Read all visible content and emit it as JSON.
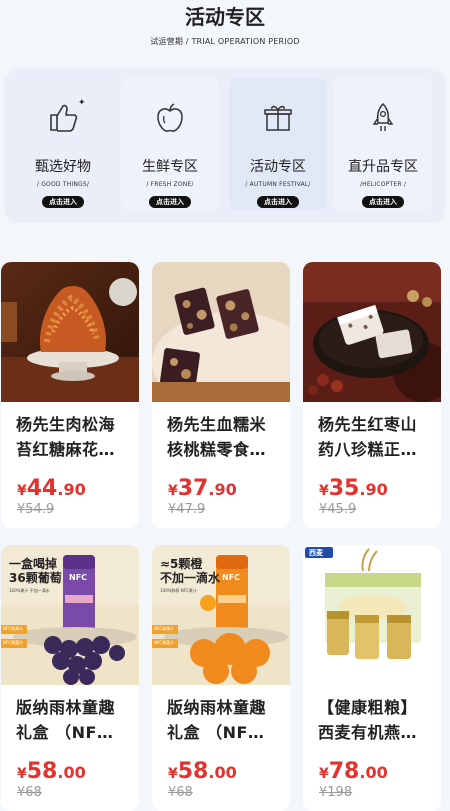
{
  "header": {
    "title": "活动专区",
    "subtitle": "试运营期 / TRIAL OPERATION PERIOD"
  },
  "categories": [
    {
      "label": "甄选好物",
      "sub": "/ GOOD THINGS/",
      "enter": "点击进入",
      "icon": "thumbs-up-icon"
    },
    {
      "label": "生鲜专区",
      "sub": "/ FRESH ZONE/",
      "enter": "点击进入",
      "icon": "apple-icon"
    },
    {
      "label": "活动专区",
      "sub": "/ AUTUMN FESTIVAL/",
      "enter": "点击进入",
      "icon": "gift-icon"
    },
    {
      "label": "直升品专区",
      "sub": "/HELICOPTER /",
      "enter": "点击进入",
      "icon": "rocket-icon"
    }
  ],
  "products": [
    {
      "line1": "杨先生肉松海",
      "line2": "苔红糖麻花…",
      "currency": "¥",
      "price_int": "44",
      "price_dec": ".90",
      "original": "¥54.9"
    },
    {
      "line1": "杨先生血糯米",
      "line2": "核桃糕零食…",
      "currency": "¥",
      "price_int": "37",
      "price_dec": ".90",
      "original": "¥47.9"
    },
    {
      "line1": "杨先生红枣山",
      "line2": "药八珍糕正…",
      "currency": "¥",
      "price_int": "35",
      "price_dec": ".90",
      "original": "¥45.9"
    },
    {
      "line1": "版纳雨林童趣",
      "line2": "礼盒 （NF…",
      "currency": "¥",
      "price_int": "58",
      "price_dec": ".00",
      "original": "¥68"
    },
    {
      "line1": "版纳雨林童趣",
      "line2": "礼盒 （NF…",
      "currency": "¥",
      "price_int": "58",
      "price_dec": ".00",
      "original": "¥68"
    },
    {
      "line1": "【健康粗粮】",
      "line2": "西麦有机燕…",
      "currency": "¥",
      "price_int": "78",
      "price_dec": ".00",
      "original": "¥198"
    }
  ],
  "image_text": {
    "grape_head": "一盒喝掉",
    "grape_sub": "36颗葡萄",
    "grape_small": "100%果汁 不加一滴水",
    "orange_head": "≈5颗橙",
    "orange_sub": "不加一滴水",
    "orange_small": "100%鲜榨 NFC果汁",
    "nfc": "NFC",
    "badge1": "NFC纯果汁",
    "badge2": "NFC果蔬汁",
    "brand": "西麦"
  },
  "colors": {
    "price": "#e2332f",
    "accent_black": "#111111"
  }
}
